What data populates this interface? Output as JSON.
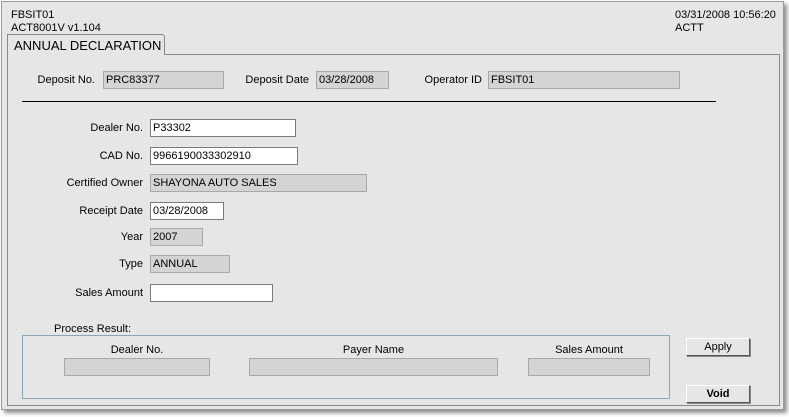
{
  "header": {
    "screen_id": "FBSIT01",
    "program": "ACT8001V  v1.104",
    "datetime": "03/31/2008 10:56:20",
    "system": "ACTT"
  },
  "tab": {
    "label": "ANNUAL DECLARATION"
  },
  "top_fields": {
    "deposit_no": {
      "label": "Deposit No.",
      "value": "PRC83377"
    },
    "deposit_date": {
      "label": "Deposit Date",
      "value": "03/28/2008"
    },
    "operator_id": {
      "label": "Operator ID",
      "value": "FBSIT01"
    }
  },
  "form": {
    "dealer_no": {
      "label": "Dealer No.",
      "value": "P33302"
    },
    "cad_no": {
      "label": "CAD No.",
      "value": "9966190033302910"
    },
    "certified_owner": {
      "label": "Certified Owner",
      "value": "SHAYONA AUTO SALES"
    },
    "receipt_date": {
      "label": "Receipt Date",
      "value": "03/28/2008"
    },
    "year": {
      "label": "Year",
      "value": "2007"
    },
    "type": {
      "label": "Type",
      "value": "ANNUAL"
    },
    "sales_amount": {
      "label": "Sales Amount",
      "value": ""
    }
  },
  "process_result": {
    "title": "Process Result:",
    "columns": [
      "Dealer No.",
      "Payer Name",
      "Sales Amount"
    ],
    "values": [
      "",
      "",
      ""
    ]
  },
  "buttons": {
    "apply": "Apply",
    "void": "Void"
  }
}
